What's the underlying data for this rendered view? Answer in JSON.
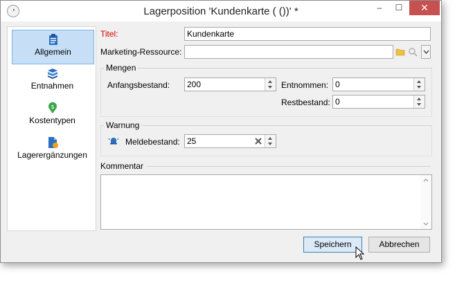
{
  "window": {
    "title": "Lagerposition 'Kundenkarte ( ())' *",
    "controls": {
      "minimize": "–",
      "maximize": "☐",
      "close": "✕"
    }
  },
  "sidebar": {
    "items": [
      {
        "label": "Allgemein",
        "icon": "clipboard-icon",
        "active": true
      },
      {
        "label": "Entnahmen",
        "icon": "boxes-icon",
        "active": false
      },
      {
        "label": "Kostentypen",
        "icon": "money-icon",
        "active": false
      },
      {
        "label": "Lagerergänzungen",
        "icon": "document-warning-icon",
        "active": false
      }
    ]
  },
  "form": {
    "titel_label": "Titel:",
    "titel_value": "Kundenkarte",
    "marketing_label": "Marketing-Ressource:",
    "marketing_value": "",
    "mengen": {
      "title": "Mengen",
      "anfangsbestand_label": "Anfangsbestand:",
      "anfangsbestand_value": "200",
      "entnommen_label": "Entnommen:",
      "entnommen_value": "0",
      "restbestand_label": "Restbestand:",
      "restbestand_value": "0"
    },
    "warnung": {
      "title": "Warnung",
      "meldebestand_label": "Meldebestand:",
      "meldebestand_value": "25"
    },
    "kommentar_label": "Kommentar",
    "kommentar_value": ""
  },
  "buttons": {
    "save": "Speichern",
    "cancel": "Abbrechen"
  },
  "colors": {
    "required_label": "#d40000",
    "active_item_bg": "#c6dff7",
    "close_button": "#c75050"
  }
}
